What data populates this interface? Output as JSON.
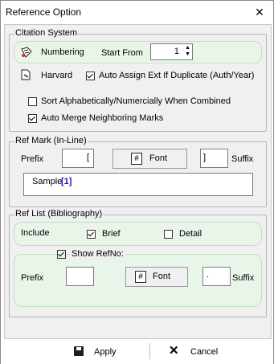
{
  "window": {
    "title": "Reference Option",
    "close_glyph": "✕"
  },
  "citation_system": {
    "legend": "Citation System",
    "numbering_label": "Numbering",
    "start_from_label": "Start From",
    "start_from_value": "1",
    "harvard_label": "Harvard",
    "auto_assign_label": "Auto Assign Ext If Duplicate (Auth/Year)",
    "auto_assign_checked": true,
    "sort_label": "Sort Alphabetically/Numercially When Combined",
    "sort_checked": false,
    "auto_merge_label": "Auto Merge Neighboring Marks",
    "auto_merge_checked": true
  },
  "ref_mark": {
    "legend": "Ref Mark (In-Line)",
    "prefix_label": "Prefix",
    "prefix_value": "[",
    "font_button": "Font",
    "suffix_value": "]",
    "suffix_label": "Suffix",
    "sample_text": "Sample",
    "sample_mark": "[1]"
  },
  "ref_list": {
    "legend": "Ref List (Bibliography)",
    "include_label": "Include",
    "brief_label": "Brief",
    "brief_checked": true,
    "detail_label": "Detail",
    "detail_checked": false,
    "show_refno_label": "Show RefNo:",
    "show_refno_checked": true,
    "prefix_label": "Prefix",
    "prefix_value": "",
    "font_button": "Font",
    "suffix_value": ".",
    "suffix_label": "Suffix"
  },
  "footer": {
    "apply_label": "Apply",
    "cancel_label": "Cancel"
  },
  "colors": {
    "sample_mark": "#1a1ab4",
    "subgroup_bg": "#eaf5ea"
  }
}
